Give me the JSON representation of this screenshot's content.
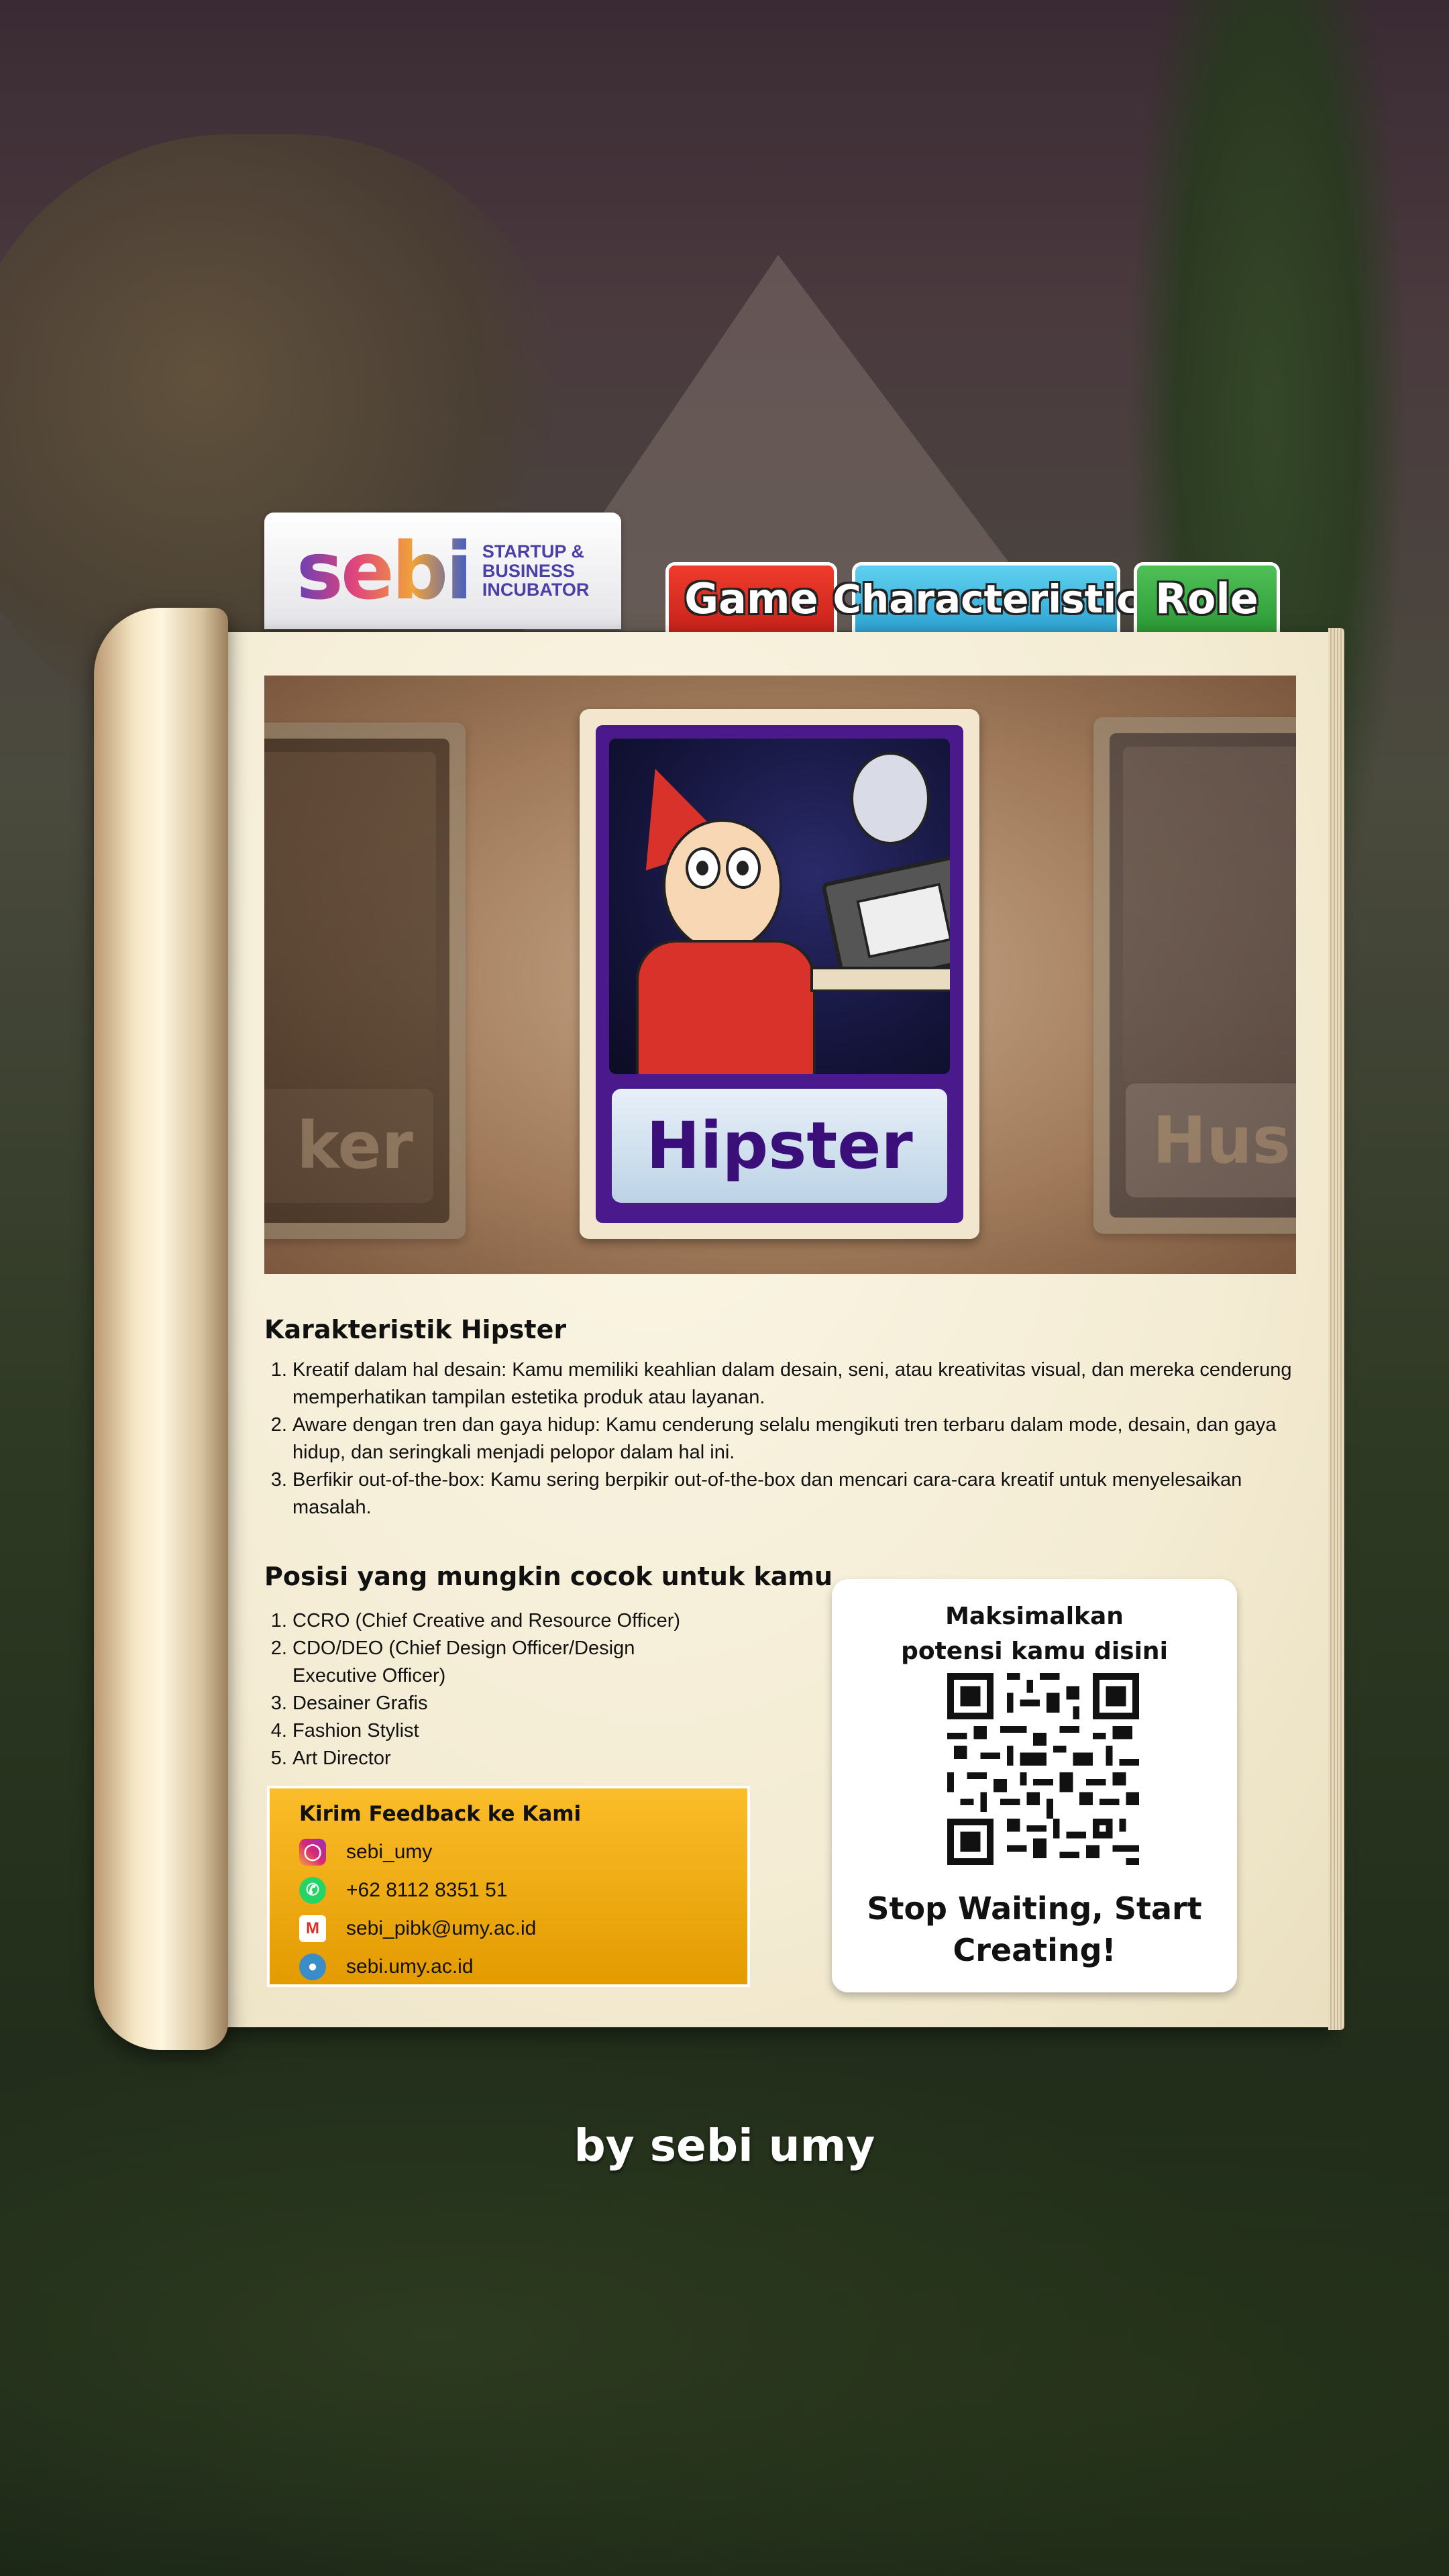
{
  "logo": {
    "wordmark": "sebi",
    "subtitle_lines": [
      "STARTUP &",
      "BUSINESS",
      "INCUBATOR"
    ]
  },
  "tabs": [
    {
      "label": "Game",
      "color": "#e0302a"
    },
    {
      "label": "Characteristic",
      "color": "#46b9e2"
    },
    {
      "label": "Role",
      "color": "#3eaa47"
    }
  ],
  "carousel": {
    "left_card_label": "ker",
    "center_card_label": "Hipster",
    "right_card_label": "Hus"
  },
  "characteristics": {
    "title": "Karakteristik Hipster",
    "items": [
      "Kreatif dalam hal desain: Kamu memiliki keahlian dalam desain, seni, atau kreativitas visual, dan mereka cenderung memperhatikan tampilan estetika produk atau layanan.",
      "Aware dengan tren dan gaya hidup: Kamu cenderung selalu mengikuti tren terbaru dalam mode, desain, dan gaya hidup, dan seringkali menjadi pelopor dalam hal ini.",
      "Berfikir out-of-the-box: Kamu sering berpikir out-of-the-box dan mencari cara-cara kreatif untuk menyelesaikan masalah."
    ]
  },
  "positions": {
    "title": "Posisi yang mungkin cocok untuk kamu",
    "items": [
      "CCRO (Chief Creative and Resource Officer)",
      "CDO/DEO (Chief Design Officer/Design Executive Officer)",
      "Desainer Grafis",
      "Fashion Stylist",
      "Art Director"
    ]
  },
  "feedback": {
    "title": "Kirim Feedback ke Kami",
    "instagram": "sebi_umy",
    "whatsapp": "+62 8112 8351 51",
    "email": "sebi_pibk@umy.ac.id",
    "website": "sebi.umy.ac.id",
    "color": "#f7b21a"
  },
  "qr_card": {
    "top_line1": "Maksimalkan",
    "top_line2": "potensi kamu disini",
    "bottom_line1": "Stop Waiting, Start",
    "bottom_line2": "Creating!"
  },
  "byline": "by sebi umy"
}
